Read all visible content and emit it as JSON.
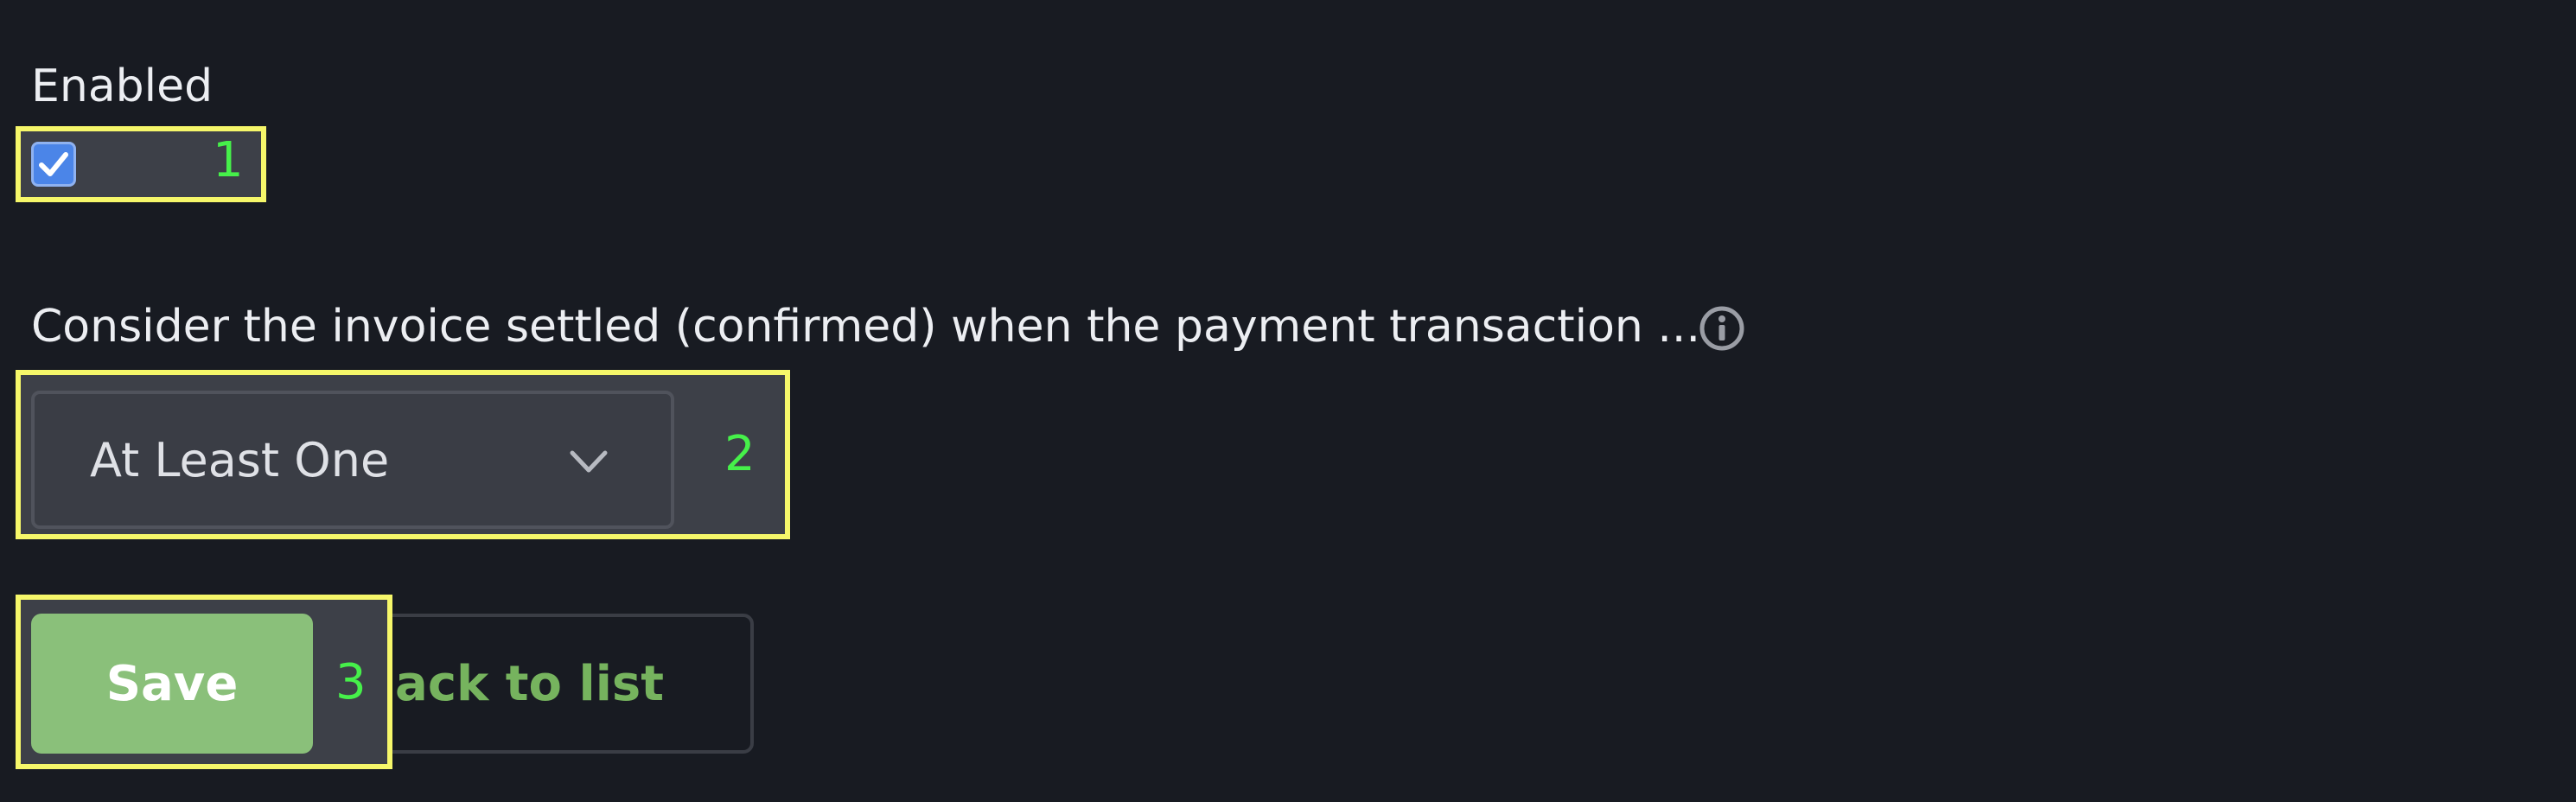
{
  "enabled": {
    "label": "Enabled",
    "checked": true
  },
  "settlement": {
    "question": "Consider the invoice settled (confirmed) when the payment transaction ...",
    "selected_option": "At Least One",
    "info_icon": "info-circle-icon",
    "dropdown_icon": "chevron-down-icon"
  },
  "actions": {
    "save_label": "Save",
    "back_label": "Back to list"
  },
  "highlights": [
    {
      "label": "1"
    },
    {
      "label": "2"
    },
    {
      "label": "3"
    }
  ],
  "colors": {
    "background": "#181b22",
    "checkbox": "#4b85e8",
    "save_button": "#8ac07a",
    "back_link": "#76b35e",
    "highlight_border": "#f6f76a",
    "highlight_label": "#46f04a"
  }
}
